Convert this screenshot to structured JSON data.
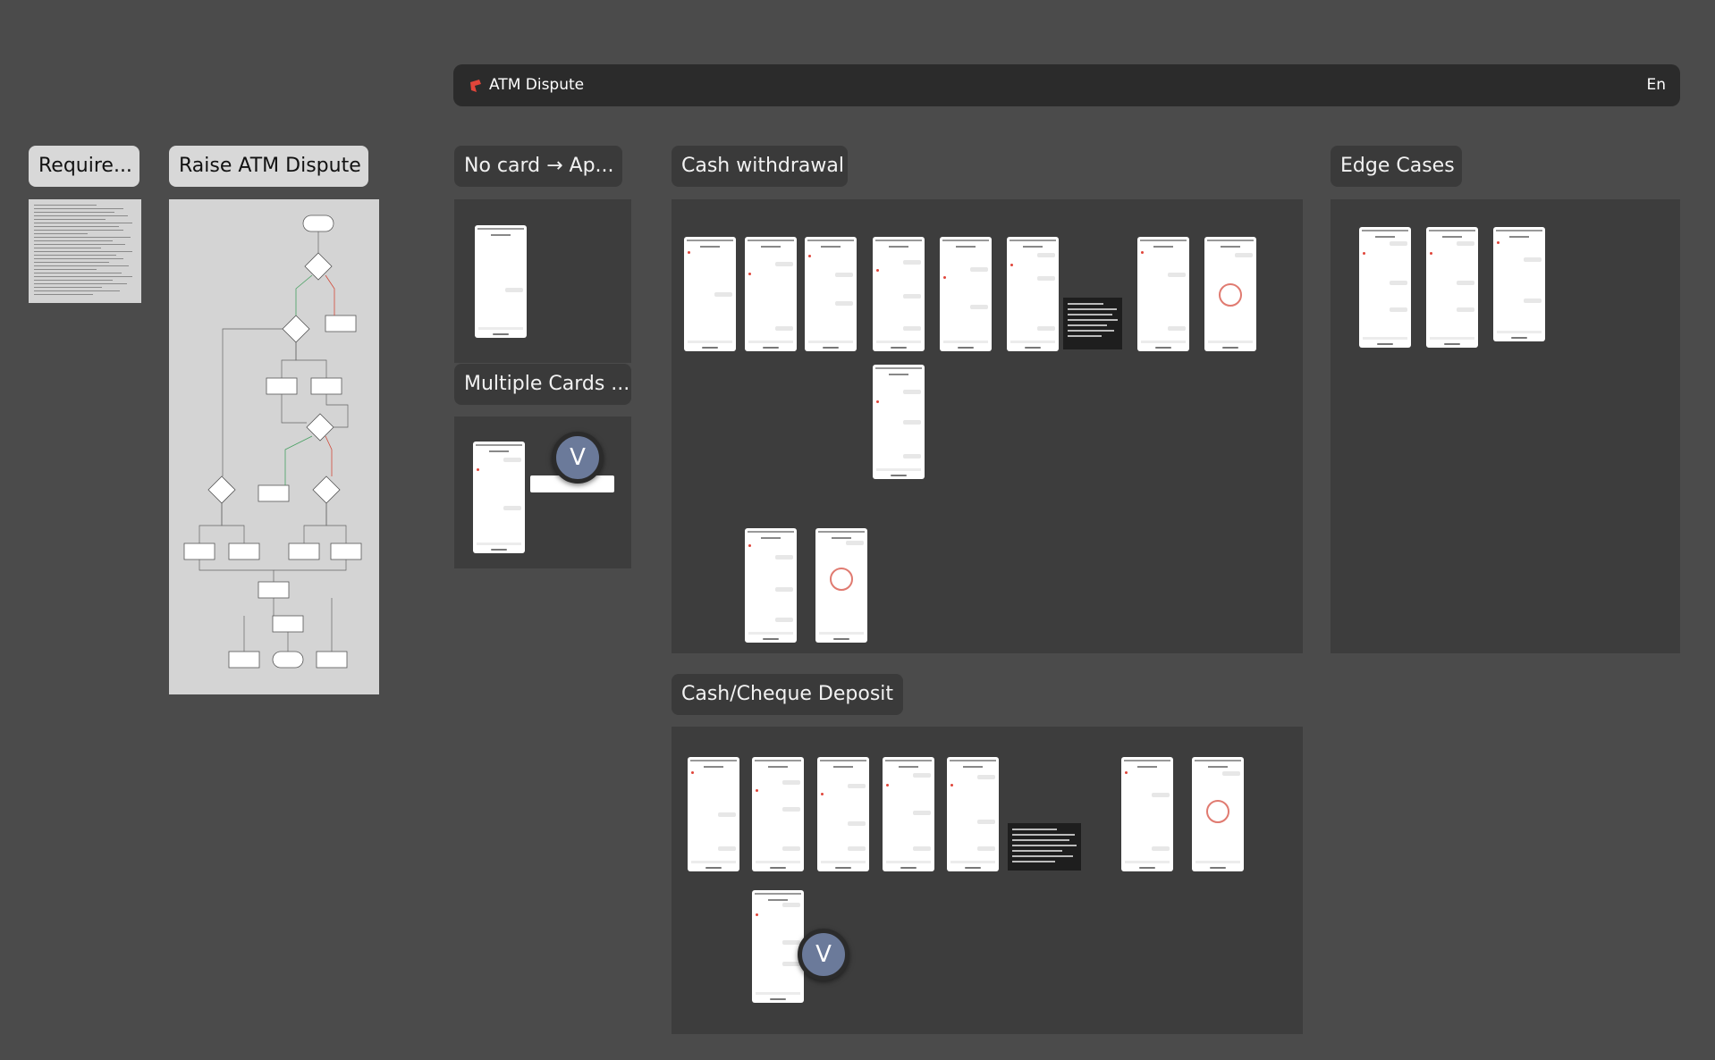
{
  "window": {
    "title": "ATM Dispute",
    "language": "En"
  },
  "boards": {
    "requirements": "Require...",
    "raise_dispute": "Raise ATM Dispute",
    "no_card": "No card → Ap...",
    "multiple_cards": "Multiple Cards ...",
    "cash_withdrawal": "Cash withdrawal",
    "edge_cases": "Edge Cases",
    "deposit": "Cash/Cheque  Deposit"
  },
  "avatars": [
    {
      "initial": "V"
    },
    {
      "initial": "V"
    }
  ],
  "colors": {
    "canvas": "#4b4b4b",
    "topbar": "#2b2b2b",
    "panel": "#3d3d3d",
    "accent": "#e0453a",
    "avatar": "#6b7a9a"
  },
  "icons": {
    "logo": "brand-logo-icon"
  }
}
